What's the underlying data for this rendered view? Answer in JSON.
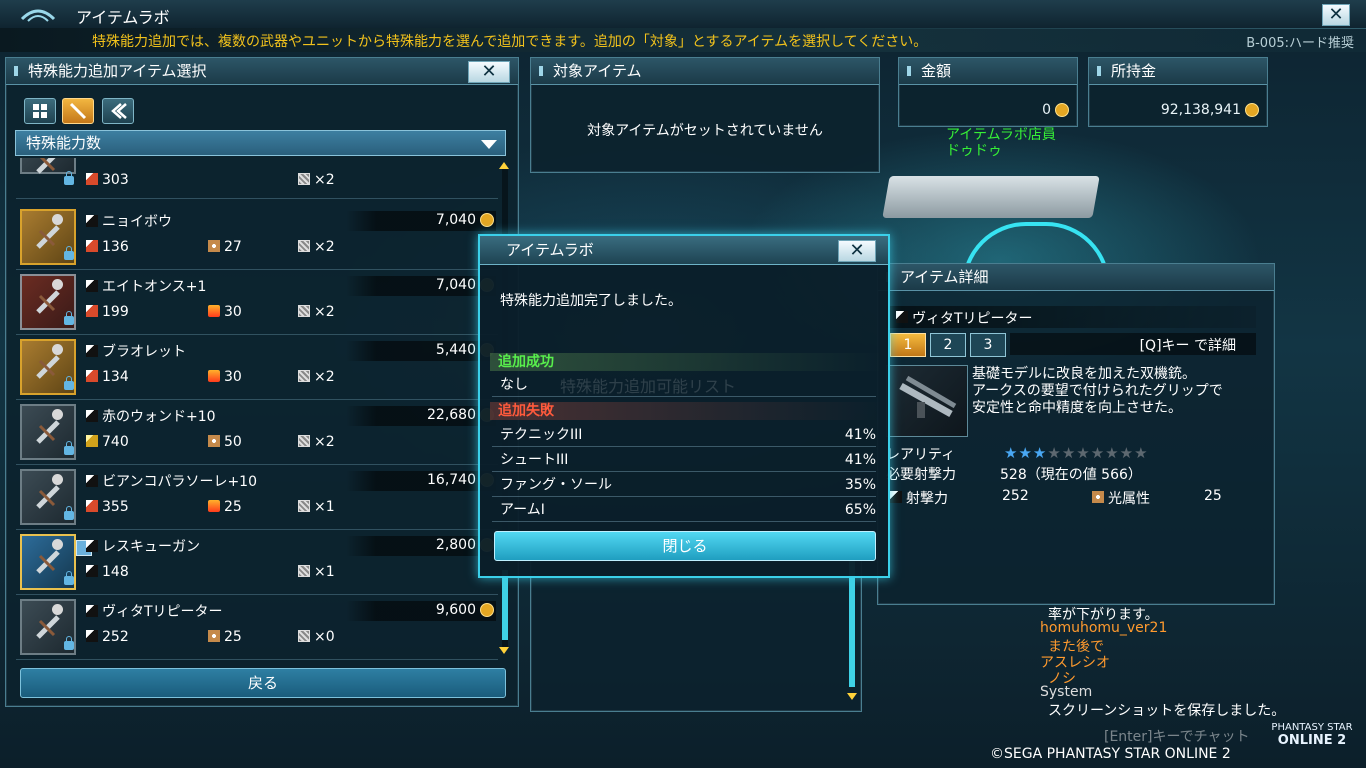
{
  "window": {
    "title": "アイテムラボ",
    "close_glyph": "✕"
  },
  "message_bar": {
    "text": "特殊能力追加では、複数の武器やユニットから特殊能力を選んで追加できます。追加の「対象」とするアイテムを選択してください。",
    "tag": "B-005:ハード推奨"
  },
  "left_panel": {
    "title": "特殊能力追加アイテム選択",
    "sort_label": "特殊能力数",
    "back_label": "戻る",
    "items": [
      {
        "name": "",
        "price": "",
        "stat1": "303",
        "stat2": "",
        "slots": "×2",
        "stat1_icon": "atk-icon",
        "stat2_icon": "",
        "thumb": "plain"
      },
      {
        "name": "ニョイボウ",
        "price": "7,040",
        "stat1": "136",
        "stat2": "27",
        "slots": "×2",
        "stat1_icon": "atk-icon",
        "stat2_icon": "element-icon",
        "thumb": "gold"
      },
      {
        "name": "エイトオンス+1",
        "price": "7,040",
        "stat1": "199",
        "stat2": "30",
        "slots": "×2",
        "stat1_icon": "atk-icon",
        "stat2_icon": "fire-icon",
        "thumb": "red"
      },
      {
        "name": "ブラオレット",
        "price": "5,440",
        "stat1": "134",
        "stat2": "30",
        "slots": "×2",
        "stat1_icon": "atk-icon",
        "stat2_icon": "fire-icon",
        "thumb": "gold"
      },
      {
        "name": "赤のウォンド+10",
        "price": "22,680",
        "stat1": "740",
        "stat2": "50",
        "slots": "×2",
        "stat1_icon": "tech-icon",
        "stat2_icon": "element-icon",
        "thumb": "plain"
      },
      {
        "name": "ビアンコパラソーレ+10",
        "price": "16,740",
        "stat1": "355",
        "stat2": "25",
        "slots": "×1",
        "stat1_icon": "atk-icon",
        "stat2_icon": "fire-icon",
        "thumb": "plain"
      },
      {
        "name": "レスキューガン",
        "price": "2,800",
        "stat1": "148",
        "stat2": "",
        "slots": "×1",
        "stat1_icon": "ranged-icon",
        "stat2_icon": "",
        "thumb": "selected"
      },
      {
        "name": "ヴィタTリピーター",
        "price": "9,600",
        "stat1": "252",
        "stat2": "25",
        "slots": "×0",
        "stat1_icon": "ranged-icon",
        "stat2_icon": "element-icon",
        "thumb": "plain"
      }
    ]
  },
  "target_panel": {
    "title": "対象アイテム",
    "empty_text": "対象アイテムがセットされていません"
  },
  "cost_panel": {
    "title": "金額",
    "value": "0"
  },
  "funds_panel": {
    "title": "所持金",
    "value": "92,138,941"
  },
  "npc": {
    "line1": "アイテムラボ店員",
    "line2": "ドゥドゥ"
  },
  "dialog": {
    "title": "アイテムラボ",
    "message": "特殊能力追加完了しました。",
    "success_label": "追加成功",
    "success_items": [
      "なし"
    ],
    "failure_label": "追加失敗",
    "failures": [
      {
        "name": "テクニックIII",
        "pct": "41%"
      },
      {
        "name": "シュートIII",
        "pct": "41%"
      },
      {
        "name": "ファング・ソール",
        "pct": "35%"
      },
      {
        "name": "アームI",
        "pct": "65%"
      }
    ],
    "close_label": "閉じる",
    "background_text": "特殊能力追加可能リスト"
  },
  "detail_panel": {
    "title": "アイテム詳細",
    "item_name": "ヴィタTリピーター",
    "tabs": [
      "1",
      "2",
      "3"
    ],
    "detail_key": "[Q]キー で詳細",
    "description": [
      "基礎モデルに改良を加えた双機銃。",
      "アークスの要望で付けられたグリップで",
      "安定性と命中精度を向上させた。"
    ],
    "rarity_label": "レアリティ",
    "rarity": 3,
    "rarity_max": 10,
    "req_label": "必要射撃力",
    "req_value": "528（現在の値 566）",
    "atk_label": "射撃力",
    "atk_value": "252",
    "elem_label": "光属性",
    "elem_value": "25"
  },
  "chat": {
    "lines": [
      {
        "text": "率が下がります。",
        "color": "#ffffff"
      },
      {
        "text": "homuhomu_ver21",
        "color": "#ff9a2e"
      },
      {
        "text": "また後で",
        "color": "#ff9a2e"
      },
      {
        "text": "アスレシオ",
        "color": "#ff9a2e"
      },
      {
        "text": "ノシ",
        "color": "#ff9a2e"
      },
      {
        "text": "System",
        "color": "#dddddd"
      },
      {
        "text": "スクリーンショットを保存しました。",
        "color": "#ffffff"
      }
    ],
    "input_hint": "[Enter]キーでチャット",
    "copyright": "©SEGA PHANTASY STAR ONLINE 2",
    "logo_line1": "PHANTASY STAR",
    "logo_line2": "ONLINE 2"
  },
  "colors": {
    "accent": "#3bd0ea",
    "success": "#58ef4c",
    "failure": "#ff5a3c",
    "message": "#f2c21c",
    "npc": "#36ef36"
  }
}
